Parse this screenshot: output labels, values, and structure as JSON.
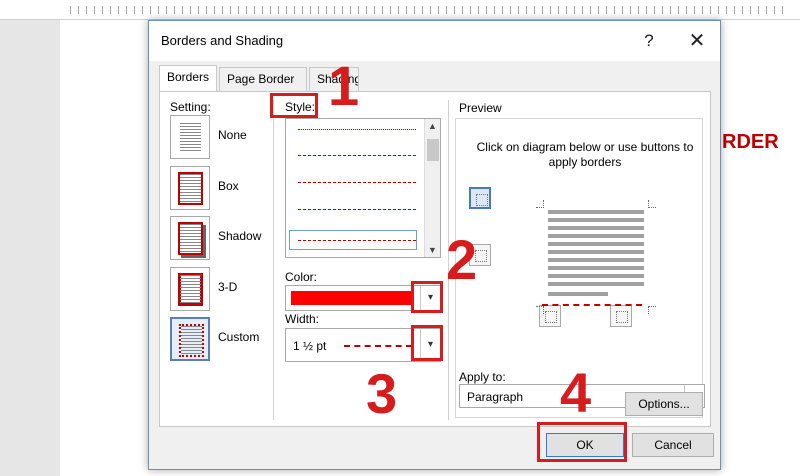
{
  "document": {
    "visible_text": "RDER"
  },
  "dialog": {
    "title": "Borders and Shading",
    "help_label": "?",
    "close_label": "✕",
    "tabs": [
      {
        "label": "Borders",
        "active": true
      },
      {
        "label": "Page Border",
        "active": false
      },
      {
        "label": "Shading",
        "active": false
      }
    ],
    "setting": {
      "label": "Setting:",
      "items": [
        {
          "label": "None",
          "icon": "border-none-icon"
        },
        {
          "label": "Box",
          "icon": "border-box-icon"
        },
        {
          "label": "Shadow",
          "icon": "border-shadow-icon"
        },
        {
          "label": "3-D",
          "icon": "border-3d-icon"
        },
        {
          "label": "Custom",
          "icon": "border-custom-icon",
          "selected": true
        }
      ]
    },
    "style": {
      "label": "Style:",
      "options": [
        "dotted",
        "dashed",
        "long-dashed",
        "dash-dot",
        "dash-dot-dot"
      ],
      "selected_index": 4
    },
    "color": {
      "label": "Color:",
      "value": "#ff0000"
    },
    "width": {
      "label": "Width:",
      "value": "1 ½ pt"
    },
    "preview": {
      "label": "Preview",
      "instruction": "Click on diagram below or use buttons to apply borders"
    },
    "apply_to": {
      "label": "Apply to:",
      "value": "Paragraph"
    },
    "options_label": "Options...",
    "ok_label": "OK",
    "cancel_label": "Cancel"
  },
  "annotations": {
    "steps": [
      "1",
      "2",
      "3",
      "4"
    ],
    "color": "#d61c1c"
  }
}
